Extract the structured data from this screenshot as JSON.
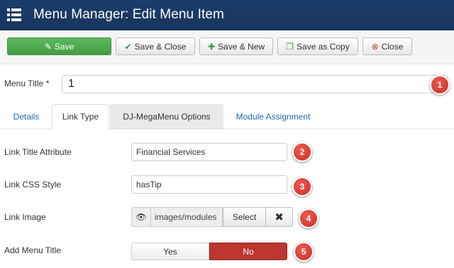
{
  "header": {
    "title": "Menu Manager: Edit Menu Item",
    "menu_icon": "menu-list-icon"
  },
  "toolbar": {
    "save": "Save",
    "save_close": "Save & Close",
    "save_new": "Save & New",
    "save_copy": "Save as Copy",
    "close": "Close"
  },
  "menu_title": {
    "label": "Menu Title *",
    "value": "1"
  },
  "tabs": [
    {
      "label": "Details"
    },
    {
      "label": "Link Type"
    },
    {
      "label": "DJ-MegaMenu Options"
    },
    {
      "label": "Module Assignment"
    }
  ],
  "fields": {
    "link_title": {
      "label": "Link Title Attribute",
      "value": "Financial Services"
    },
    "link_css": {
      "label": "Link CSS Style",
      "value": "hasTip"
    },
    "link_image": {
      "label": "Link Image",
      "path": "images/modules",
      "select": "Select"
    },
    "add_menu_title": {
      "label": "Add Menu Title",
      "yes": "Yes",
      "no": "No"
    }
  },
  "badges": [
    "1",
    "2",
    "3",
    "4",
    "5"
  ],
  "colors": {
    "header": "#1c3d6b",
    "save_green": "#5cb85c",
    "toggle_no": "#bd362f",
    "badge_red": "#d9362c"
  }
}
